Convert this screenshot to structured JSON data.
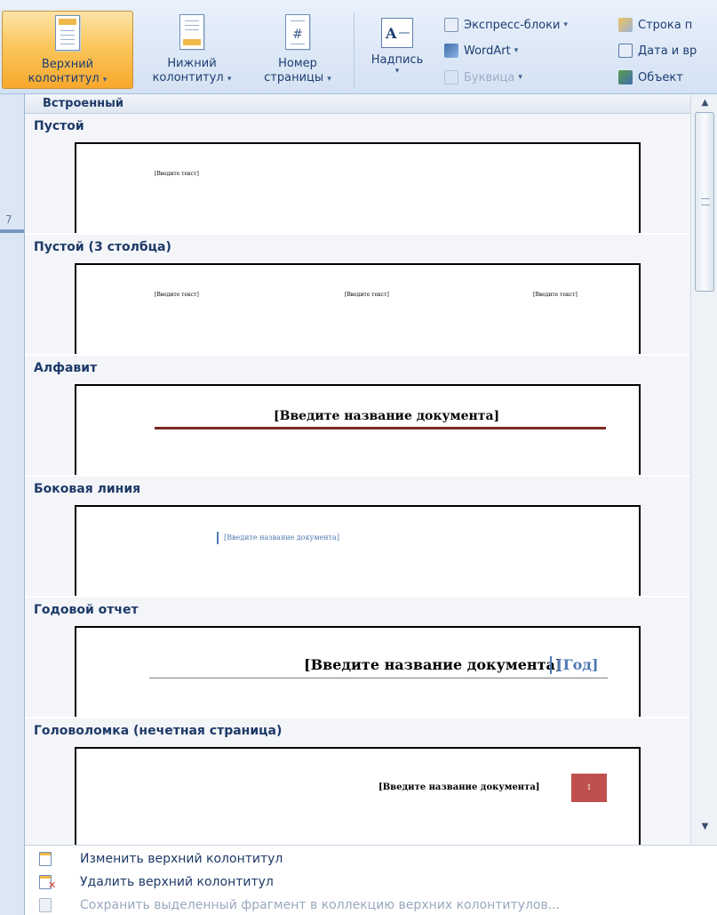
{
  "ribbon": {
    "header_button": {
      "line1": "Верхний",
      "line2": "колонтитул"
    },
    "footer_button": {
      "line1": "Нижний",
      "line2": "колонтитул"
    },
    "page_number_button": {
      "line1": "Номер",
      "line2": "страницы"
    },
    "textbox_button": {
      "label": "Надпись"
    },
    "quick_parts": "Экспресс-блоки",
    "wordart": "WordArt",
    "dropcap": "Буквица",
    "signature_line": "Строка п",
    "date_time": "Дата и вр",
    "object": "Объект"
  },
  "side_marker": "7",
  "gallery": {
    "category": "Встроенный",
    "items": [
      {
        "title": "Пустой",
        "placeholder": "[Введите текст]"
      },
      {
        "title": "Пустой (3 столбца)",
        "placeholders": [
          "[Введите текст]",
          "[Введите текст]",
          "[Введите текст]"
        ]
      },
      {
        "title": "Алфавит",
        "placeholder": "[Введите название документа]",
        "accent": "#7b2a25"
      },
      {
        "title": "Боковая линия",
        "placeholder": "[Введите название документа]",
        "accent": "#4f7ab3"
      },
      {
        "title": "Годовой отчет",
        "placeholder": "[Введите название документа]",
        "year": "[Год]",
        "accent": "#4f7ab3"
      },
      {
        "title": "Головоломка (нечетная страница)",
        "placeholder": "[Введите название документа]",
        "page_badge": "1",
        "accent": "#c0504d"
      }
    ]
  },
  "footer_menu": {
    "edit": "Изменить верхний колонтитул",
    "remove": "Удалить верхний колонтитул",
    "save_selection": "Сохранить выделенный фрагмент в коллекцию верхних колонтитулов..."
  },
  "colors": {
    "active_button": "#fbc65d",
    "title_text": "#1e3a68",
    "preview_border": "#000000"
  }
}
